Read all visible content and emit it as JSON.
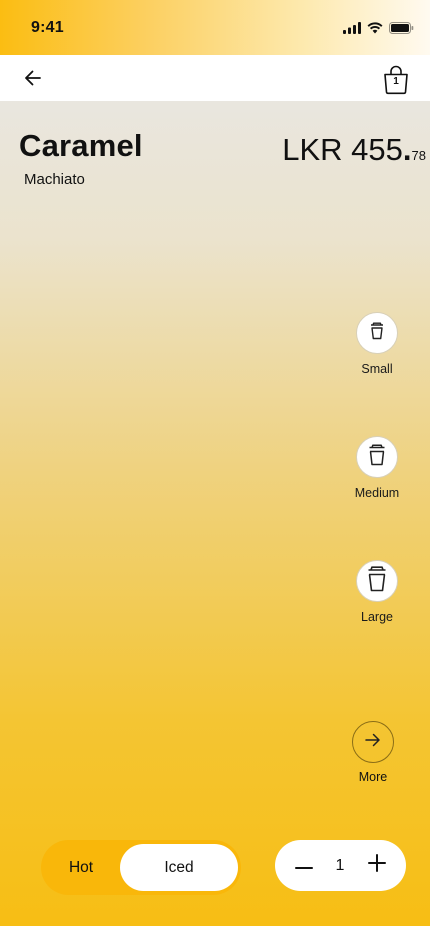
{
  "status_bar": {
    "time": "9:41"
  },
  "nav": {
    "cart_count": "1"
  },
  "product": {
    "name": "Caramel",
    "variant": "Machiato",
    "price": {
      "currency_amount": "LKR 455",
      "separator": ".",
      "cents": "78"
    }
  },
  "sizes": [
    {
      "label": "Small",
      "icon": "cup-small-icon"
    },
    {
      "label": "Medium",
      "icon": "cup-medium-icon"
    },
    {
      "label": "Large",
      "icon": "cup-large-icon"
    }
  ],
  "more": {
    "label": "More",
    "icon": "arrow-right-icon"
  },
  "temperature": {
    "options": [
      "Hot",
      "Iced"
    ],
    "selected": "Iced"
  },
  "quantity": {
    "value": "1"
  },
  "colors": {
    "accent": "#f9b70a",
    "surface": "#ffffff",
    "text": "#111111"
  }
}
